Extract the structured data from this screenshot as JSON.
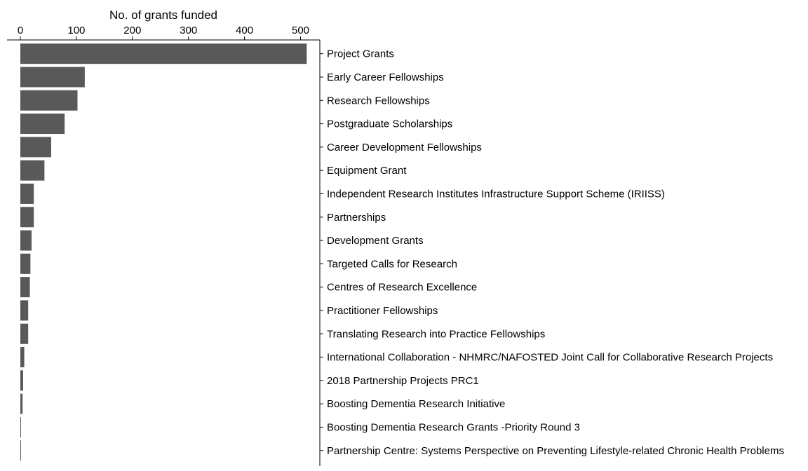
{
  "chart_data": {
    "type": "bar",
    "orientation": "horizontal",
    "title": "",
    "xlabel": "No. of grants funded",
    "ylabel": "",
    "x_axis_position": "top",
    "category_axis_position": "right",
    "xlim": [
      0,
      520
    ],
    "xticks": [
      0,
      100,
      200,
      300,
      400,
      500
    ],
    "grid": false,
    "bar_color": "#595959",
    "categories": [
      "Project Grants",
      "Early Career Fellowships",
      "Research Fellowships",
      "Postgraduate Scholarships",
      "Career Development Fellowships",
      "Equipment Grant",
      "Independent Research Institutes Infrastructure Support Scheme (IRIISS)",
      "Partnerships",
      "Development Grants",
      "Targeted Calls for Research",
      "Centres of Research Excellence",
      "Practitioner Fellowships",
      "Translating Research into Practice Fellowships",
      "International Collaboration - NHMRC/NAFOSTED Joint Call for Collaborative Research Projects",
      "2018 Partnership Projects PRC1",
      "Boosting Dementia Research Initiative",
      "Boosting Dementia Research Grants -Priority Round 3",
      "Partnership Centre: Systems Perspective on Preventing Lifestyle-related Chronic Health Problems"
    ],
    "values": [
      511,
      115,
      102,
      79,
      55,
      43,
      24,
      24,
      20,
      18,
      17,
      14,
      14,
      7,
      5,
      4,
      1,
      1
    ]
  }
}
